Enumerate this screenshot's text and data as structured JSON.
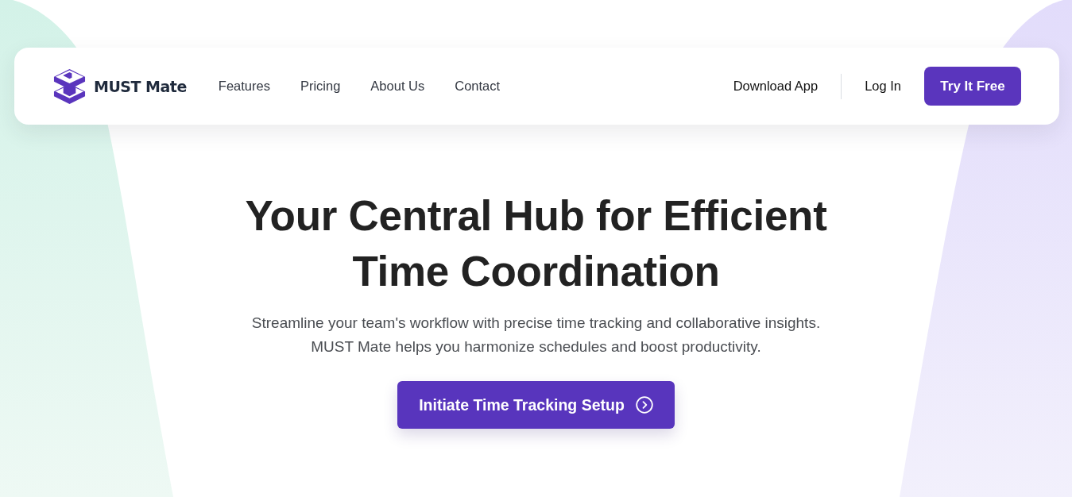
{
  "brand": {
    "name": "MUST Mate"
  },
  "nav": {
    "links": [
      "Features",
      "Pricing",
      "About Us",
      "Contact"
    ],
    "download": "Download App",
    "login": "Log In",
    "cta": "Try It Free"
  },
  "hero": {
    "title_lines": [
      "Your Central Hub for Efficient",
      "Time Coordination"
    ],
    "subtitle_lines": [
      "Streamline your team's workflow with precise time tracking and collaborative insights.",
      "MUST Mate helps you harmonize schedules and boost productivity."
    ],
    "button": "Initiate Time Tracking Setup"
  }
}
